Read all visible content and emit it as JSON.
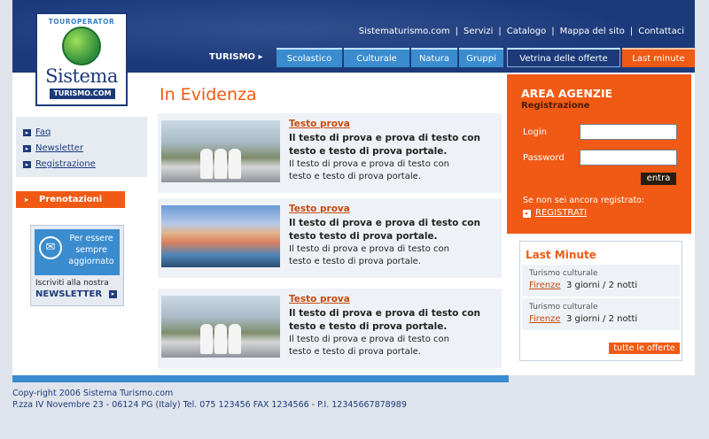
{
  "logo": {
    "tour": "TOUROPERATOR",
    "sistema": "Sistema",
    "turismo": "TURISMO.COM"
  },
  "toplinks": [
    "Sistematurismo.com",
    "Servizi",
    "Catalogo",
    "Mappa del sito",
    "Contattaci"
  ],
  "nav": {
    "label": "TURISMO",
    "tabs": [
      "Scolastico",
      "Culturale",
      "Natura",
      "Gruppi"
    ],
    "vetrina": "Vetrina delle offerte",
    "lastminute": "Last minute"
  },
  "leftmenu": [
    "Faq",
    "Newsletter",
    "Registrazione"
  ],
  "prenotazioni": "Prenotazioni",
  "newsletter_box": {
    "text": "Per essere sempre aggiornato",
    "subscribe": "Iscriviti alla nostra",
    "newsletter": "NEWSLETTER"
  },
  "main": {
    "heading": "In Evidenza",
    "articles": [
      {
        "title": "Testo prova",
        "bold": "Il testo di prova e prova di testo con testo e testo di prova portale.",
        "text": "Il testo di prova e prova di testo con testo e testo di prova portale."
      },
      {
        "title": "Testo prova",
        "bold": "Il testo di prova e prova di testo con testo testo di prova portale.",
        "text": "Il testo di prova e prova di testo con testo e testo di prova portale."
      },
      {
        "title": "Testo prova",
        "bold": "Il testo di prova e prova di testo con testo e testo di prova portale.",
        "text": "Il testo di prova e prova di testo con testo e testo di prova portale."
      }
    ]
  },
  "agenzie": {
    "title": "AREA AGENZIE",
    "subtitle": "Registrazione",
    "login_label": "Login",
    "login_value": "",
    "password_label": "Password",
    "password_value": "",
    "submit": "entra",
    "note": "Se non sei ancora registrato:",
    "register": "REGISTRATI"
  },
  "lastminute": {
    "title": "Last Minute",
    "items": [
      {
        "category": "Turismo culturale",
        "city": "Firenze",
        "duration": "3 giorni / 2 notti"
      },
      {
        "category": "Turismo culturale",
        "city": "Firenze",
        "duration": "3 giorni / 2 notti"
      }
    ],
    "all_offers": "tutte le offerte"
  },
  "footer": {
    "line1": "Copy-right 2006 Sistema Turismo.com",
    "line2": "P.zza IV Novembre 23 - 06124 PG (Italy) Tel. 075 123456 FAX 1234566 - P.I. 12345667878989"
  },
  "colors": {
    "navy": "#1c3a7a",
    "blue": "#3a8ccf",
    "orange": "#f05a14"
  }
}
